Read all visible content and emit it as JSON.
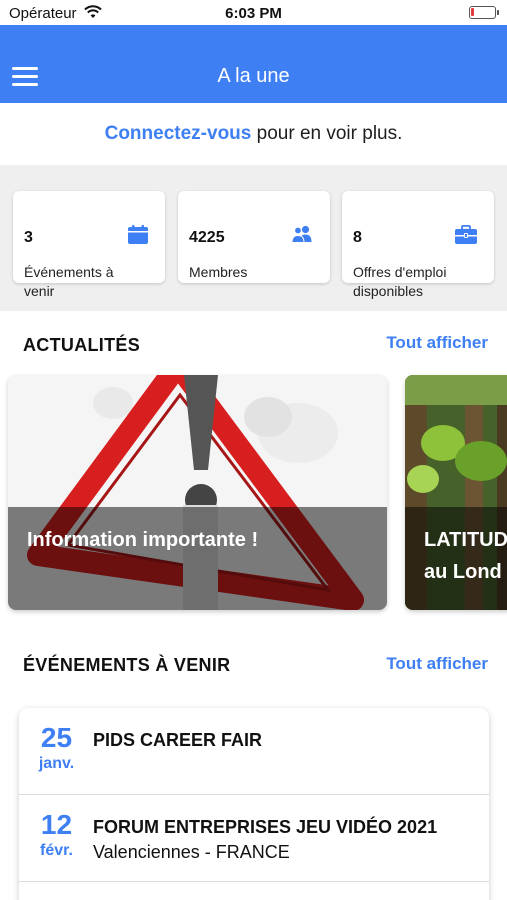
{
  "status_bar": {
    "carrier": "Opérateur",
    "time": "6:03 PM",
    "wifi_icon": "wifi-icon",
    "battery_icon": "battery-low-icon",
    "battery_level": 0.1
  },
  "header": {
    "title": "A la une",
    "menu_icon": "hamburger-menu-icon",
    "color": "#3e7ff3"
  },
  "login_banner": {
    "link": "Connectez-vous",
    "text": " pour en voir plus."
  },
  "stats": [
    {
      "value": "3",
      "label": "Événements à venir",
      "icon": "calendar-icon"
    },
    {
      "value": "4225",
      "label": "Membres",
      "icon": "users-icon"
    },
    {
      "value": "8",
      "label": "Offres d'emploi disponibles",
      "icon": "briefcase-icon"
    }
  ],
  "news": {
    "title": "ACTUALITÉS",
    "see_all": "Tout afficher",
    "items": [
      {
        "caption": "Information importante !"
      },
      {
        "caption": "LATITUD",
        "caption_line2": "au Lond"
      }
    ]
  },
  "events": {
    "title": "ÉVÉNEMENTS À VENIR",
    "see_all": "Tout afficher",
    "items": [
      {
        "day": "25",
        "month": "janv.",
        "name": "PIDS CAREER FAIR",
        "place": ""
      },
      {
        "day": "12",
        "month": "févr.",
        "name": "FORUM ENTREPRISES JEU VIDÉO 2021",
        "place": "Valenciennes - FRANCE"
      }
    ]
  },
  "colors": {
    "accent": "#3e7ff3",
    "background": "#f0f0f0"
  }
}
